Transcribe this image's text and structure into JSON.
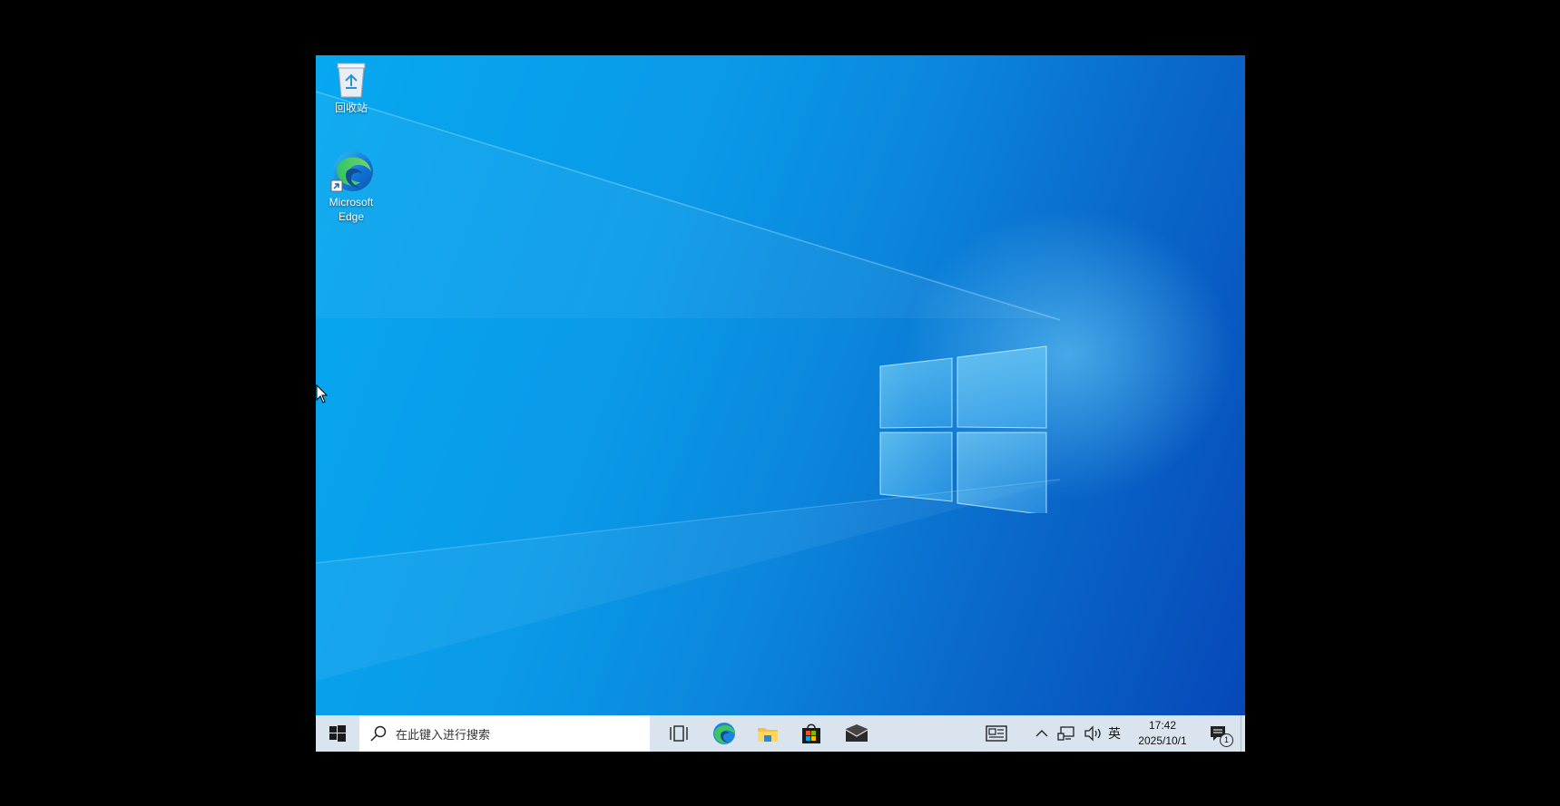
{
  "desktop": {
    "icons": [
      {
        "label": "回收站",
        "icon": "recycle-bin-icon"
      },
      {
        "label": "Microsoft Edge",
        "icon": "edge-icon"
      }
    ]
  },
  "taskbar": {
    "start_icon": "windows-logo-icon",
    "search_placeholder": "在此键入进行搜索",
    "pinned": [
      "task-view-icon",
      "edge-icon",
      "file-explorer-icon",
      "store-icon",
      "mail-icon"
    ],
    "tray": {
      "news_icon": "news-icon",
      "chevron_icon": "chevron-up-icon",
      "network_icon": "network-icon",
      "volume_icon": "volume-icon",
      "ime": "英",
      "time": "17:42",
      "date": "2025/10/1",
      "notification_count": "1"
    }
  },
  "colors": {
    "taskbar": "#d9e4ef",
    "wallpaper_light": "#06a8f0",
    "wallpaper_dark": "#0648b8"
  }
}
